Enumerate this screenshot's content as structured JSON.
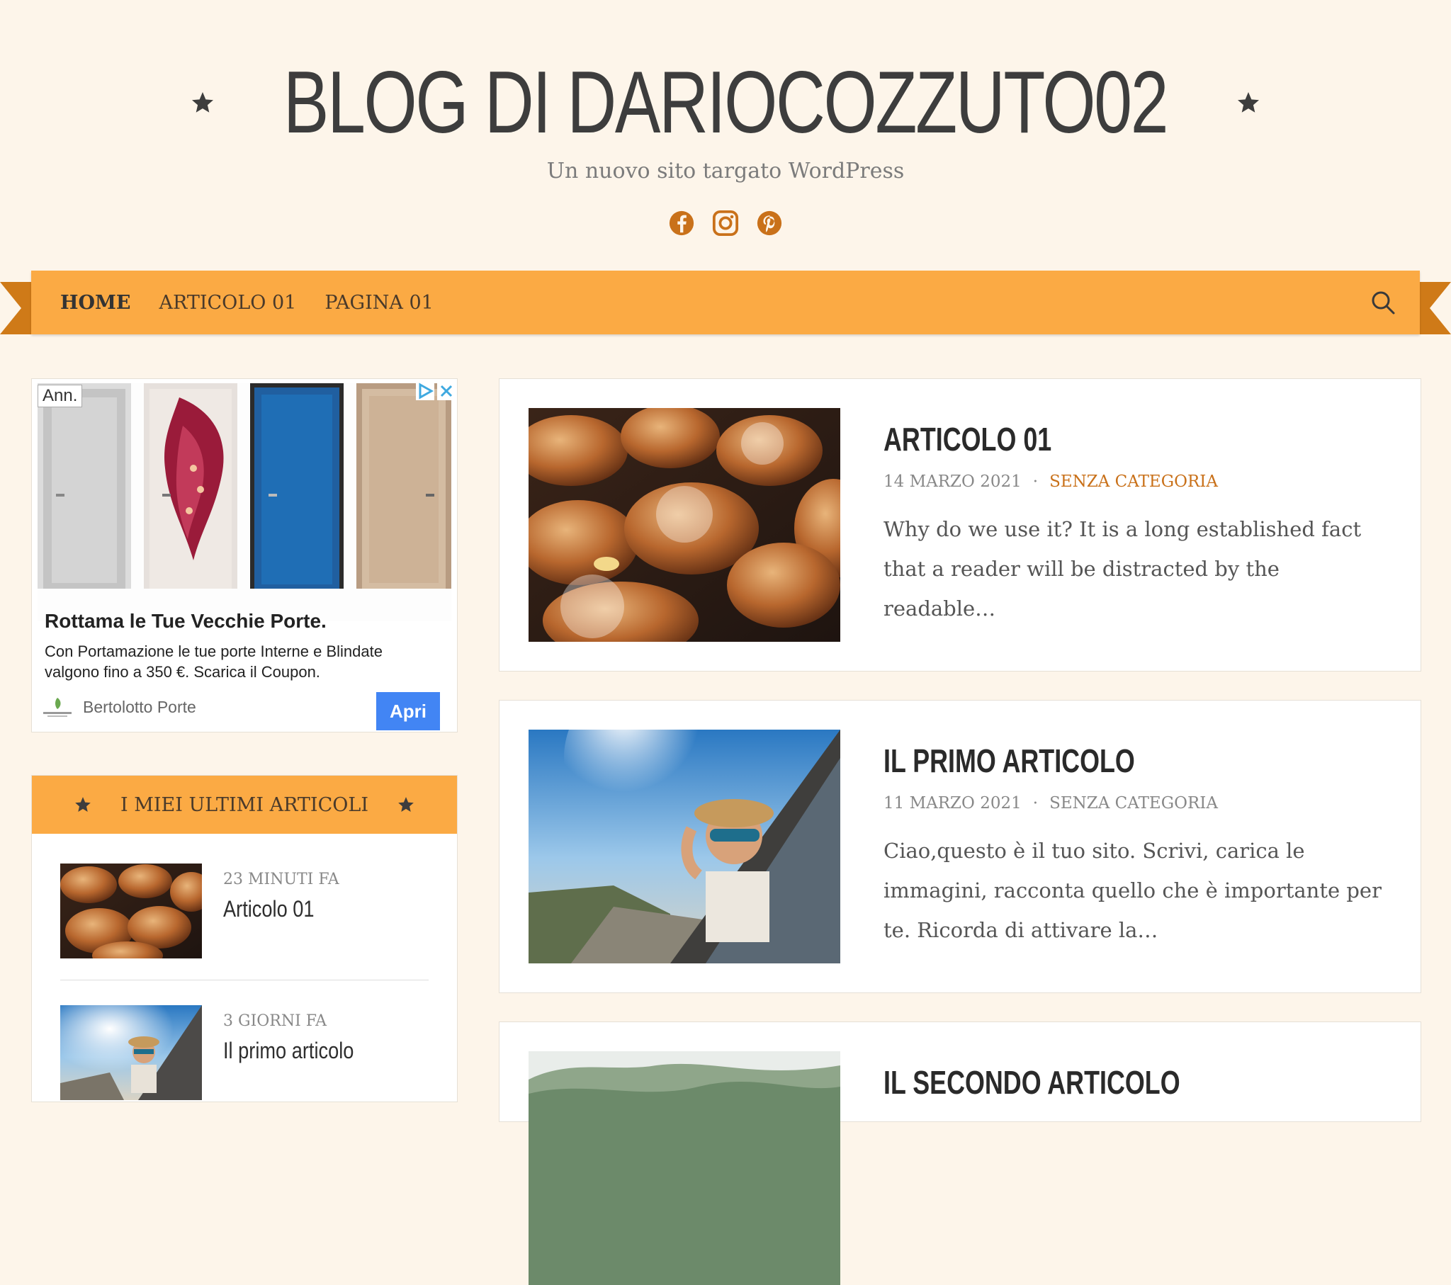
{
  "site": {
    "title": "BLOG DI DARIOCOZZUTO02",
    "tagline": "Un nuovo sito targato WordPress",
    "accent_color": "#fbaa44",
    "link_color": "#c9711a",
    "social_icons": [
      "facebook-icon",
      "instagram-icon",
      "pinterest-icon"
    ]
  },
  "nav": {
    "items": [
      {
        "label": "HOME"
      },
      {
        "label": "ARTICOLO 01"
      },
      {
        "label": "PAGINA 01"
      }
    ]
  },
  "ad": {
    "badge": "Ann.",
    "headline": "Rottama le Tue Vecchie Porte.",
    "body": "Con Portamazione le tue porte Interne e Blindate valgono fino a 350 €. Scarica il Coupon.",
    "advertiser": "Bertolotto Porte",
    "cta": "Apri",
    "cta_color": "#4285f4"
  },
  "sidebar_widget": {
    "title": "I MIEI ULTIMI ARTICOLI",
    "items": [
      {
        "time": "23 MINUTI FA",
        "title": "Articolo 01"
      },
      {
        "time": "3 GIORNI FA",
        "title": "Il primo articolo"
      }
    ]
  },
  "posts": [
    {
      "title": "ARTICOLO 01",
      "date": "14 MARZO 2021",
      "separator": "·",
      "category": "SENZA CATEGORIA",
      "excerpt": "Why do we use it? It is a long established fact that a reader will be distracted by the readable…"
    },
    {
      "title": "IL PRIMO ARTICOLO",
      "date": "11 MARZO 2021",
      "separator": "·",
      "category": "SENZA CATEGORIA",
      "excerpt": "Ciao,questo è il tuo sito. Scrivi, carica le immagini, racconta quello che è importante per te. Ricorda di attivare la…"
    },
    {
      "title": "IL SECONDO ARTICOLO"
    }
  ]
}
